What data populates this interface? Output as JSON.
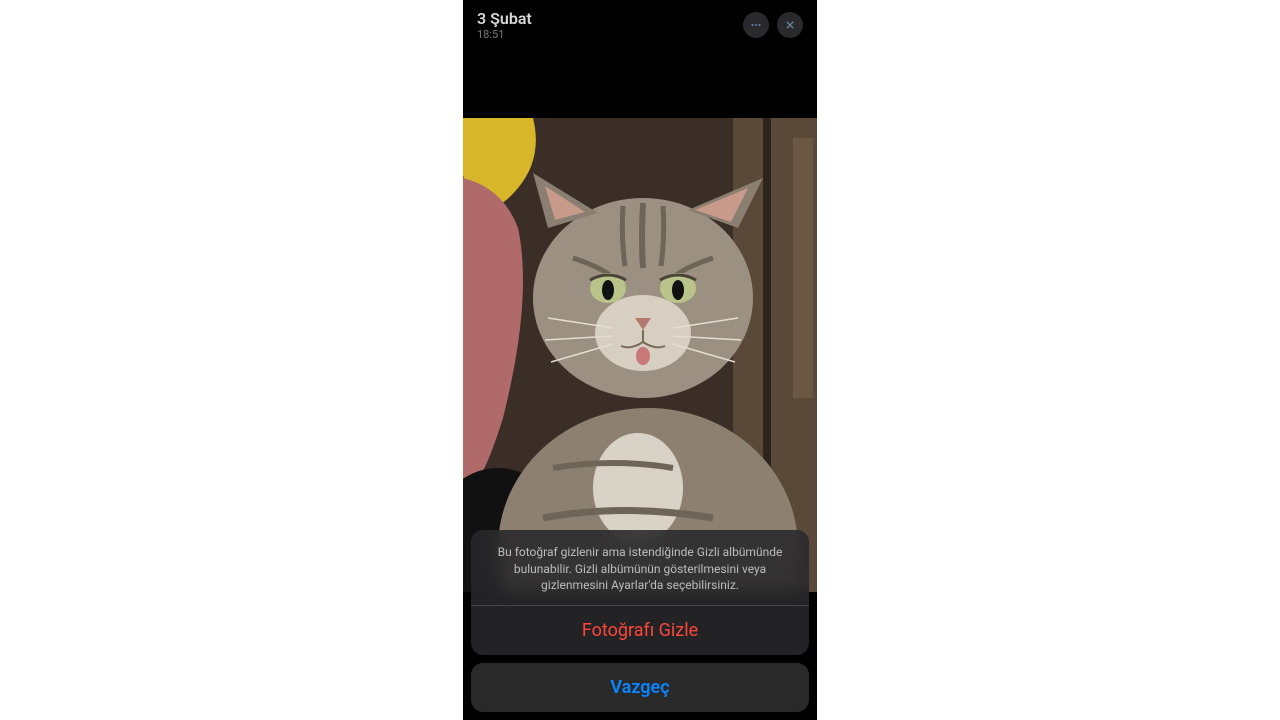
{
  "header": {
    "date": "3 Şubat",
    "time": "18:51",
    "more_icon": "ellipsis-icon",
    "close_icon": "close-icon"
  },
  "photo": {
    "description": "cat-photo"
  },
  "action_sheet": {
    "message": "Bu fotoğraf gizlenir ama istendiğinde Gizli albümünde bulunabilir. Gizli albümünün gösterilmesini veya gizlenmesini Ayarlar'da seçebilirsiniz.",
    "destructive_label": "Fotoğrafı Gizle",
    "cancel_label": "Vazgeç"
  },
  "colors": {
    "destructive": "#ff453a",
    "accent": "#0a84ff",
    "sheet_bg": "#28282a"
  }
}
